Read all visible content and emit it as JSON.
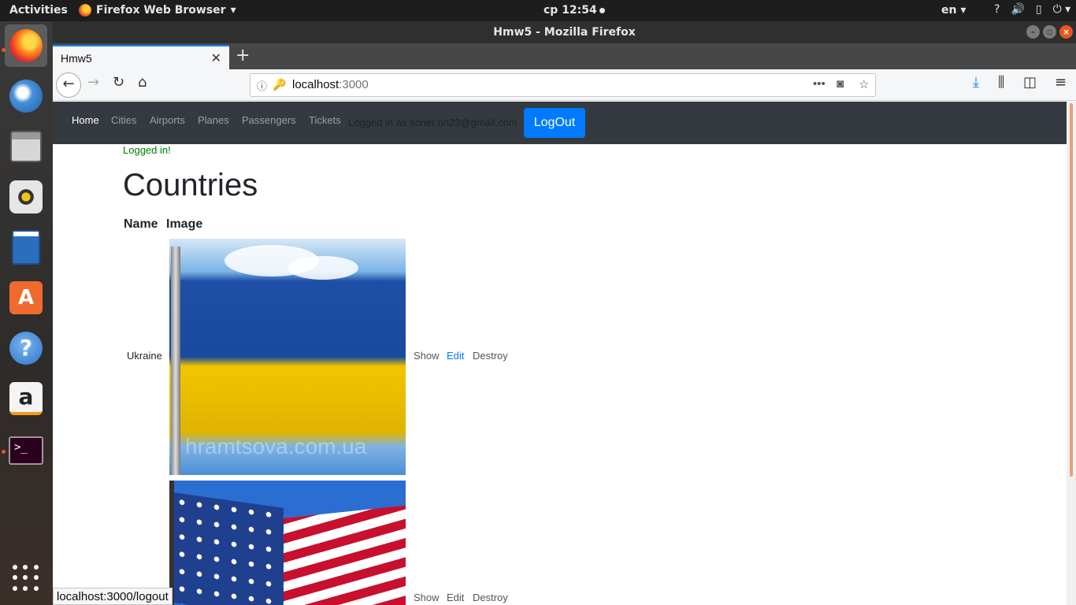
{
  "topbar": {
    "activities": "Activities",
    "app_menu": "Firefox Web Browser",
    "clock": "ср 12:54",
    "lang": "en",
    "icons": [
      "help-icon",
      "volume-icon",
      "battery-icon",
      "power-icon"
    ]
  },
  "dock": {
    "items": [
      "firefox",
      "thunderbird",
      "files",
      "rhythmbox",
      "libreoffice-writer",
      "software",
      "help",
      "amazon",
      "terminal",
      "show-applications"
    ]
  },
  "window": {
    "title": "Hmw5 - Mozilla Firefox"
  },
  "browser": {
    "tab_title": "Hmw5",
    "url_host": "localhost",
    "url_port": ":3000",
    "status_url": "localhost:3000/logout"
  },
  "site_nav": {
    "links": [
      "Home",
      "Cities",
      "Airports",
      "Planes",
      "Passengers",
      "Tickets"
    ],
    "logged_in_text": "Logged in as soner.on23@gmail.com",
    "logout_label": "LogOut"
  },
  "notice": "Logged in!",
  "page_title": "Countries",
  "table": {
    "headers": [
      "Name",
      "Image"
    ],
    "rows": [
      {
        "name": "Ukraine",
        "image": "ukraine-flag",
        "image_watermark": "hramtsova.com.ua",
        "actions": [
          "Show",
          "Edit",
          "Destroy"
        ]
      },
      {
        "name": "",
        "image": "usa-flag",
        "actions": [
          "Show",
          "Edit",
          "Destroy"
        ]
      }
    ]
  },
  "colors": {
    "navbar_bg": "#343a40",
    "logout_bg": "#007bff",
    "notice": "#008000",
    "accent": "#e95420"
  }
}
